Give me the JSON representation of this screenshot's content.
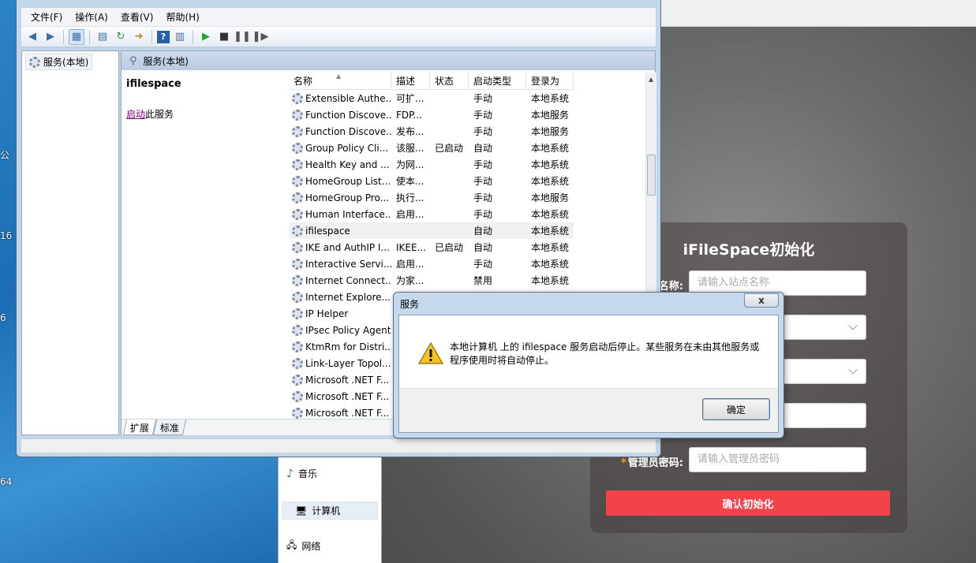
{
  "desktop": {
    "labels": [
      "公",
      "16",
      "6",
      "64"
    ]
  },
  "explorer": {
    "items": [
      {
        "label": "音乐"
      },
      {
        "label": "计算机"
      },
      {
        "label": "网络"
      }
    ]
  },
  "window": {
    "menu": [
      "文件(F)",
      "操作(A)",
      "查看(V)",
      "帮助(H)"
    ],
    "tree_root": "服务(本地)",
    "panel_title": "服务(本地)",
    "selected_service": "ifilespace",
    "action_link": "启动",
    "action_suffix": "此服务",
    "columns": [
      "名称",
      "描述",
      "状态",
      "启动类型",
      "登录为"
    ],
    "rows": [
      {
        "name": "Extensible Authe...",
        "desc": "可扩...",
        "status": "",
        "startup": "手动",
        "logon": "本地系统"
      },
      {
        "name": "Function Discove...",
        "desc": "FDP...",
        "status": "",
        "startup": "手动",
        "logon": "本地服务"
      },
      {
        "name": "Function Discove...",
        "desc": "发布...",
        "status": "",
        "startup": "手动",
        "logon": "本地服务"
      },
      {
        "name": "Group Policy Cli...",
        "desc": "该服...",
        "status": "已启动",
        "startup": "自动",
        "logon": "本地系统"
      },
      {
        "name": "Health Key and ...",
        "desc": "为网...",
        "status": "",
        "startup": "手动",
        "logon": "本地系统"
      },
      {
        "name": "HomeGroup List...",
        "desc": "使本...",
        "status": "",
        "startup": "手动",
        "logon": "本地系统"
      },
      {
        "name": "HomeGroup Pro...",
        "desc": "执行...",
        "status": "",
        "startup": "手动",
        "logon": "本地服务"
      },
      {
        "name": "Human Interface...",
        "desc": "启用...",
        "status": "",
        "startup": "手动",
        "logon": "本地系统"
      },
      {
        "name": "ifilespace",
        "desc": "",
        "status": "",
        "startup": "自动",
        "logon": "本地系统"
      },
      {
        "name": "IKE and AuthIP I...",
        "desc": "IKEE...",
        "status": "已启动",
        "startup": "自动",
        "logon": "本地系统"
      },
      {
        "name": "Interactive Servi...",
        "desc": "启用...",
        "status": "",
        "startup": "手动",
        "logon": "本地系统"
      },
      {
        "name": "Internet Connect...",
        "desc": "为家...",
        "status": "",
        "startup": "禁用",
        "logon": "本地系统"
      },
      {
        "name": "Internet Explore...",
        "desc": "",
        "status": "",
        "startup": "",
        "logon": ""
      },
      {
        "name": "IP Helper",
        "desc": "",
        "status": "",
        "startup": "",
        "logon": ""
      },
      {
        "name": "IPsec Policy Agent",
        "desc": "",
        "status": "",
        "startup": "",
        "logon": ""
      },
      {
        "name": "KtmRm for Distri...",
        "desc": "",
        "status": "",
        "startup": "",
        "logon": ""
      },
      {
        "name": "Link-Layer Topol...",
        "desc": "",
        "status": "",
        "startup": "",
        "logon": ""
      },
      {
        "name": "Microsoft .NET F...",
        "desc": "",
        "status": "",
        "startup": "",
        "logon": ""
      },
      {
        "name": "Microsoft .NET F...",
        "desc": "",
        "status": "",
        "startup": "",
        "logon": ""
      },
      {
        "name": "Microsoft .NET F...",
        "desc": "",
        "status": "",
        "startup": "",
        "logon": ""
      }
    ],
    "tabs": [
      "扩展",
      "标准"
    ]
  },
  "dialog": {
    "title": "服务",
    "close_label": "x",
    "message": "本地计算机 上的 ifilespace 服务启动后停止。某些服务在未由其他服务或程序使用时将自动停止。",
    "ok_label": "确定"
  },
  "web": {
    "title": "iFileSpace初始化",
    "fields": [
      {
        "label": "名称:",
        "placeholder": "请输入站点名称",
        "type": "text"
      },
      {
        "label": "",
        "placeholder": "",
        "type": "select"
      },
      {
        "label": "",
        "placeholder": "",
        "type": "select"
      },
      {
        "label": "",
        "placeholder": "",
        "type": "text"
      },
      {
        "label": "管理员密码:",
        "placeholder": "请输入管理员密码",
        "type": "password"
      }
    ],
    "submit_label": "确认初始化"
  },
  "colors": {
    "accent_red": "#f2434a",
    "star": "#ff9a2e",
    "link": "#800080"
  }
}
